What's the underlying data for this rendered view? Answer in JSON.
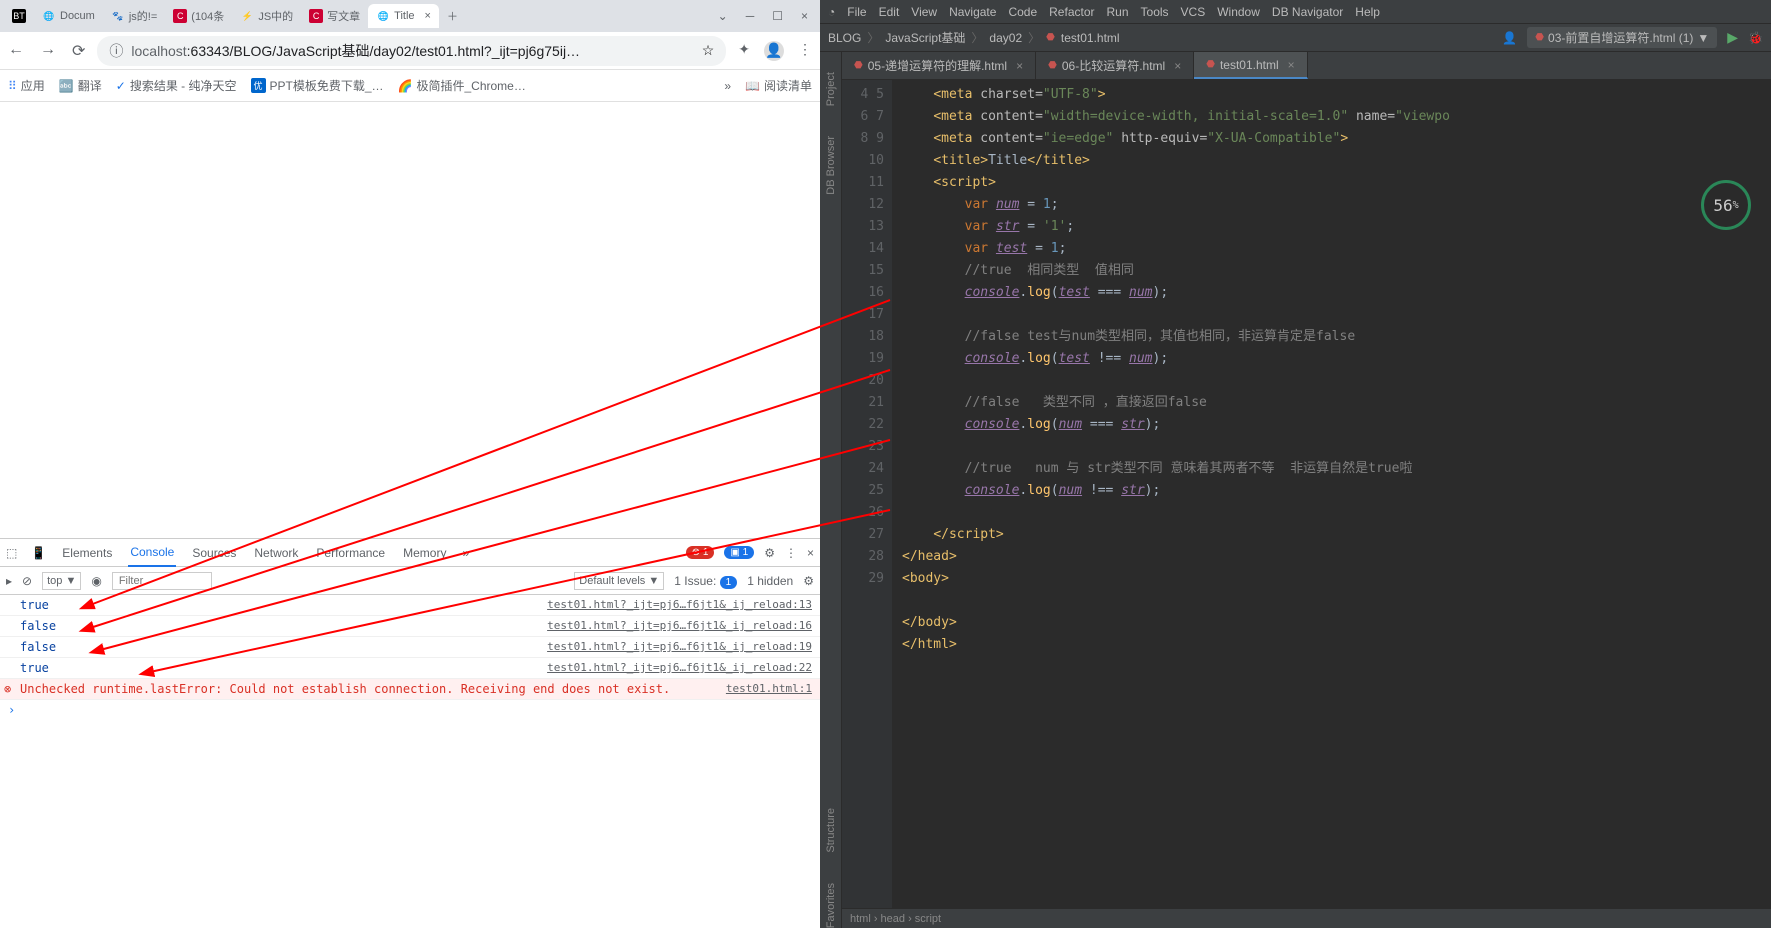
{
  "browser": {
    "tabs": [
      {
        "label": "BT"
      },
      {
        "label": "Docum"
      },
      {
        "label": "js的!="
      },
      {
        "label": "(104条"
      },
      {
        "label": "JS中的"
      },
      {
        "label": "写文章"
      },
      {
        "label": "Title",
        "active": true
      }
    ],
    "url_prefix": "localhost",
    "url_rest": ":63343/BLOG/JavaScript基础/day02/test01.html?_ijt=pj6g75ij…",
    "bookmarks": [
      "应用",
      "翻译",
      "搜索结果 - 纯净天空",
      "PPT模板免费下载_…",
      "极简插件_Chrome…"
    ],
    "reading_list": "阅读清单"
  },
  "devtools": {
    "tabs": [
      "Elements",
      "Console",
      "Sources",
      "Network",
      "Performance",
      "Memory"
    ],
    "active_tab": "Console",
    "err_count": "1",
    "info_count": "1",
    "context": "top ▼",
    "filter_ph": "Filter",
    "levels": "Default levels ▼",
    "issues": "1 Issue:",
    "issues_badge": "1",
    "hidden": "1 hidden",
    "logs": [
      {
        "v": "true",
        "src": "test01.html?_ijt=pj6…f6jt1&_ij_reload:13"
      },
      {
        "v": "false",
        "src": "test01.html?_ijt=pj6…f6jt1&_ij_reload:16"
      },
      {
        "v": "false",
        "src": "test01.html?_ijt=pj6…f6jt1&_ij_reload:19"
      },
      {
        "v": "true",
        "src": "test01.html?_ijt=pj6…f6jt1&_ij_reload:22"
      }
    ],
    "error_msg": "Unchecked runtime.lastError: Could not establish connection. Receiving end does not exist.",
    "error_src": "test01.html:1"
  },
  "ide": {
    "menu": [
      "File",
      "Edit",
      "View",
      "Navigate",
      "Code",
      "Refactor",
      "Run",
      "Tools",
      "VCS",
      "Window",
      "DB Navigator",
      "Help"
    ],
    "breadcrumbs": [
      "BLOG",
      "JavaScript基础",
      "day02",
      "test01.html"
    ],
    "run_config": "03-前置自增运算符.html (1)",
    "badge": "56",
    "side": [
      "Project",
      "DB Browser",
      "Structure",
      "Favorites"
    ],
    "editor_tabs": [
      {
        "label": "05-递增运算符的理解.html"
      },
      {
        "label": "06-比较运算符.html"
      },
      {
        "label": "test01.html",
        "active": true
      }
    ],
    "status": "html › head › script",
    "lines_start": 4,
    "lines_end": 29
  }
}
